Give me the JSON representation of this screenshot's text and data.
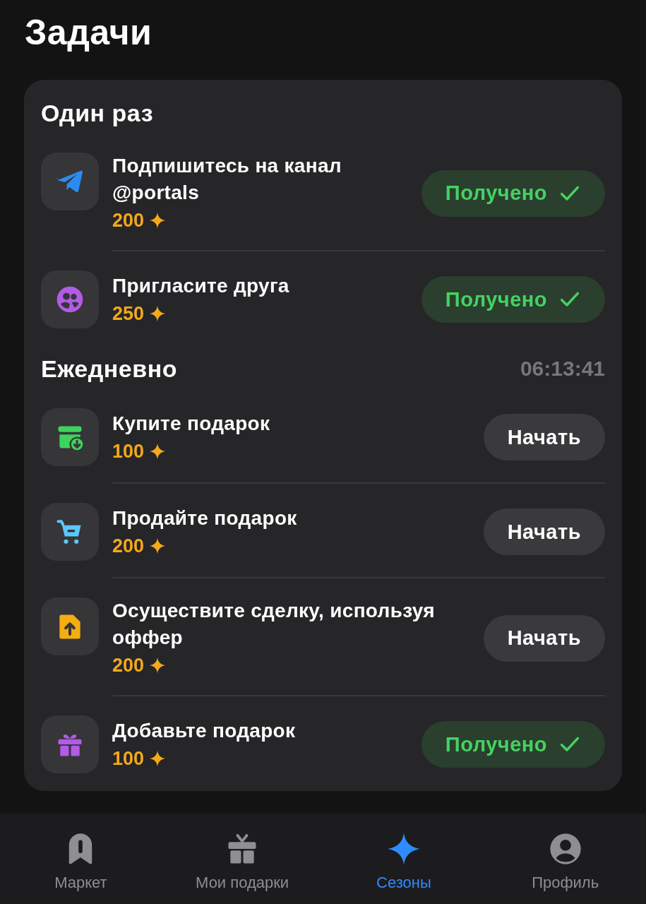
{
  "screen": {
    "title": "Задачи"
  },
  "sections": [
    {
      "title": "Один раз",
      "tasks": [
        {
          "kind": "plane",
          "title": "Подпишитесь на канал @portals",
          "reward": "200",
          "done": true,
          "action": "Получено"
        },
        {
          "kind": "people",
          "title": "Пригласите друга",
          "reward": "250",
          "done": true,
          "action": "Получено"
        }
      ]
    },
    {
      "title": "Ежедневно",
      "timer": "06:13:41",
      "tasks": [
        {
          "kind": "box",
          "title": "Купите подарок",
          "reward": "100",
          "done": false,
          "action": "Начать"
        },
        {
          "kind": "cart",
          "title": "Продайте подарок",
          "reward": "200",
          "done": false,
          "action": "Начать"
        },
        {
          "kind": "document",
          "title": "Осуществите сделку, используя оффер",
          "reward": "200",
          "done": false,
          "action": "Начать"
        },
        {
          "kind": "gift",
          "title": "Добавьте подарок",
          "reward": "100",
          "done": true,
          "action": "Получено"
        }
      ]
    }
  ],
  "tab_bar": [
    {
      "kind": "market",
      "label": "Маркет",
      "selected": false
    },
    {
      "kind": "gift",
      "label": "Мои подарки",
      "selected": false
    },
    {
      "kind": "sparkle",
      "label": "Сезоны",
      "selected": true
    },
    {
      "kind": "profile",
      "label": "Профиль",
      "selected": false
    }
  ]
}
